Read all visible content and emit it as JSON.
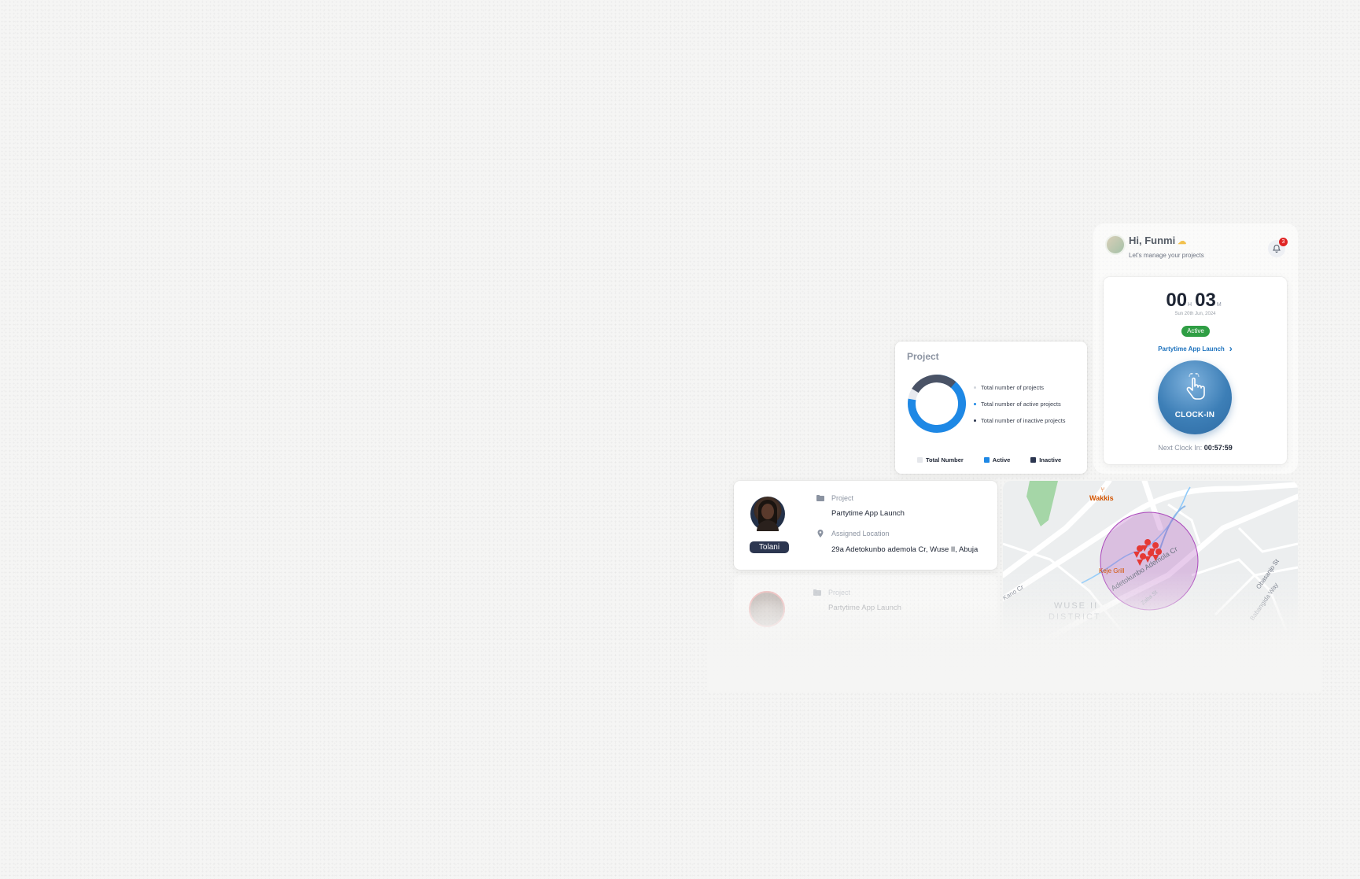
{
  "greeting": {
    "title": "Hi, Funmi",
    "subtitle": "Let's manage your projects",
    "notification_count": "3"
  },
  "clock": {
    "hours": "00",
    "hours_unit": "H",
    "minutes": "03",
    "minutes_unit": "M",
    "date": "Sun 20th Jun, 2024",
    "status": "Active",
    "status_color": "#2f9e44",
    "project_link": "Partytime App Launch",
    "button_label": "CLOCK-IN",
    "next_label": "Next Clock In:",
    "next_time": "00:57:59"
  },
  "project_chart": {
    "title": "Project",
    "metrics": [
      {
        "label": "Total number of projects",
        "color": "#e5e7eb"
      },
      {
        "label": "Total number of active projects",
        "color": "#1e88e5"
      },
      {
        "label": "Total number of inactive projects",
        "color": "#2c3650"
      }
    ],
    "legend": [
      {
        "label": "Total Number",
        "color": "#e5e7eb"
      },
      {
        "label": "Active",
        "color": "#1e88e5"
      },
      {
        "label": "Inactive",
        "color": "#2c3650"
      }
    ]
  },
  "employees": [
    {
      "name": "Tolani",
      "project_label": "Project",
      "project": "Partytime App Launch",
      "location_label": "Assigned Location",
      "location": "29a Adetokunbo ademola Cr, Wuse II, Abuja"
    },
    {
      "name": "",
      "project_label": "Project",
      "project": "Partytime App Launch"
    }
  ],
  "map": {
    "labels": [
      "Wakkis",
      "Keje Grill",
      "Adetokunbo Ademola Cr",
      "Kano Cr",
      "WUSE II",
      "DISTRICT",
      "Obasanjo St",
      "Babangida Way",
      "Zaba St"
    ]
  }
}
